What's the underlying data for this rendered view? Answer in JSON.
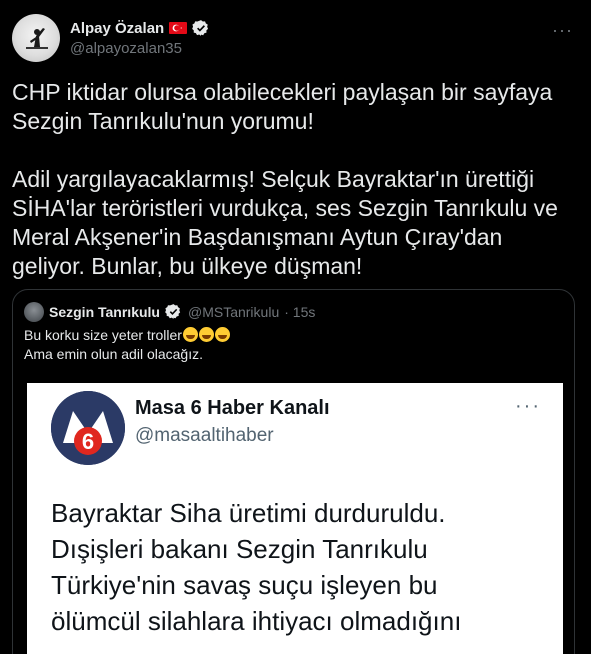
{
  "author": {
    "name": "Alpay Özalan",
    "handle": "@alpayozalan35",
    "flag_color": "#e30a17",
    "verified_color": "#e7e9ea"
  },
  "more_icon": "···",
  "tweet_text": "CHP iktidar olursa olabilecekleri paylaşan bir sayfaya\nSezgin Tanrıkulu'nun yorumu!\n\nAdil yargılayacaklarmış! Selçuk Bayraktar'ın ürettiği\nSİHA'lar teröristleri vurdukça, ses Sezgin Tanrıkulu ve\nMeral Akşener'in Başdanışmanı Aytun Çıray'dan\ngeliyor. Bunlar, bu ülkeye düşman!",
  "quote": {
    "name": "Sezgin Tanrıkulu",
    "handle": "@MSTanrikulu",
    "time": "· 15s",
    "line1": "Bu korku size yeter troller",
    "line2": "Ama emin olun adil olacağız.",
    "emoji": [
      "grinning-sweat-emoji",
      "grinning-sweat-emoji",
      "grinning-sweat-emoji"
    ]
  },
  "embedded": {
    "name": "Masa 6 Haber Kanalı",
    "handle": "@masaaltihaber",
    "more_icon": "···",
    "text": "Bayraktar Siha üretimi durduruldu.\nDışişleri bakanı Sezgin Tanrıkulu\nTürkiye'nin savaş suçu işleyen bu\nölümcül silahlara ihtiyacı olmadığını",
    "logo_text": "6"
  }
}
